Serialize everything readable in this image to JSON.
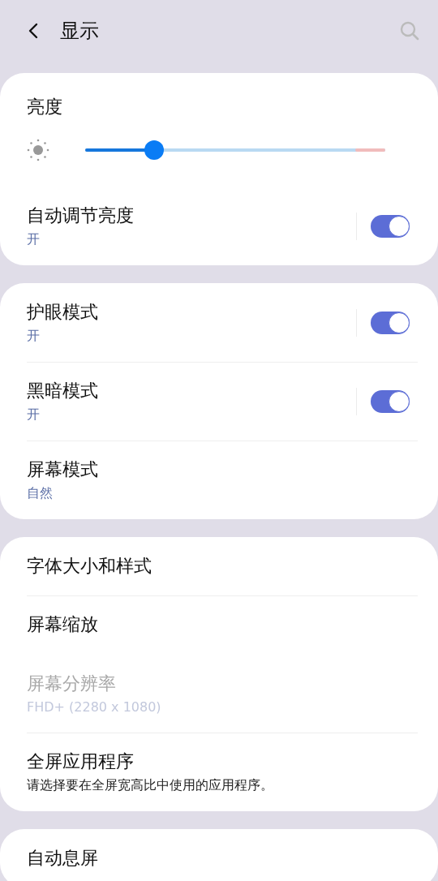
{
  "header": {
    "title": "显示"
  },
  "groups": [
    {
      "items": [
        {
          "kind": "slider",
          "title": "亮度",
          "level": 0.23
        },
        {
          "kind": "switch",
          "title": "自动调节亮度",
          "subtitle": "开",
          "accent": true,
          "on": true
        }
      ]
    },
    {
      "items": [
        {
          "kind": "switch",
          "title": "护眼模式",
          "subtitle": "开",
          "accent": true,
          "on": true
        },
        {
          "kind": "switch",
          "title": "黑暗模式",
          "subtitle": "开",
          "accent": true,
          "on": true
        },
        {
          "kind": "link",
          "title": "屏幕模式",
          "subtitle": "自然",
          "accent": true
        }
      ]
    },
    {
      "items": [
        {
          "kind": "link",
          "title": "字体大小和样式"
        },
        {
          "kind": "link",
          "title": "屏幕缩放"
        },
        {
          "kind": "link",
          "title": "屏幕分辨率",
          "subtitle": "FHD+ (2280 x 1080)",
          "accent": true,
          "disabled": true
        },
        {
          "kind": "link",
          "title": "全屏应用程序",
          "subtitle": "请选择要在全屏宽高比中使用的应用程序。",
          "accent": false
        }
      ]
    },
    {
      "items": [
        {
          "kind": "link",
          "title": "自动息屏"
        }
      ]
    }
  ]
}
